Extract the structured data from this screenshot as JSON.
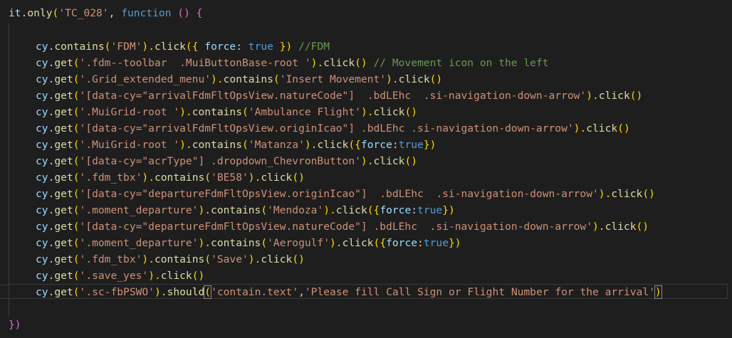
{
  "editor": {
    "lines": [
      {
        "tokens": [
          {
            "t": "it",
            "c": "obj"
          },
          {
            "t": ".",
            "c": "pun"
          },
          {
            "t": "only",
            "c": "fn"
          },
          {
            "t": "(",
            "c": "br2"
          },
          {
            "t": "'TC_028'",
            "c": "str"
          },
          {
            "t": ", ",
            "c": "pun"
          },
          {
            "t": "function",
            "c": "bool"
          },
          {
            "t": " ",
            "c": "pun"
          },
          {
            "t": "()",
            "c": "par"
          },
          {
            "t": " ",
            "c": "pun"
          },
          {
            "t": "{",
            "c": "par"
          }
        ]
      },
      {
        "tokens": [
          {
            "t": "cy",
            "c": "obj"
          },
          {
            "t": ".",
            "c": "pun"
          },
          {
            "t": "contains",
            "c": "fn"
          },
          {
            "t": "(",
            "c": "br2"
          },
          {
            "t": "'FDM'",
            "c": "str"
          },
          {
            "t": ").",
            "c": "br2"
          },
          {
            "t": "click",
            "c": "fn"
          },
          {
            "t": "({ ",
            "c": "br2"
          },
          {
            "t": "force",
            "c": "prop"
          },
          {
            "t": ": ",
            "c": "pun"
          },
          {
            "t": "true",
            "c": "bool"
          },
          {
            "t": " })",
            "c": "br2"
          },
          {
            "t": " //FDM",
            "c": "cm"
          }
        ]
      },
      {
        "tokens": [
          {
            "t": "cy",
            "c": "obj"
          },
          {
            "t": ".",
            "c": "pun"
          },
          {
            "t": "get",
            "c": "fn"
          },
          {
            "t": "(",
            "c": "br2"
          },
          {
            "t": "'.fdm--toolbar  .MuiButtonBase-root '",
            "c": "str"
          },
          {
            "t": ").",
            "c": "br2"
          },
          {
            "t": "click",
            "c": "fn"
          },
          {
            "t": "()",
            "c": "br2"
          },
          {
            "t": " // Movement icon on the left",
            "c": "cm"
          }
        ]
      },
      {
        "tokens": [
          {
            "t": "cy",
            "c": "obj"
          },
          {
            "t": ".",
            "c": "pun"
          },
          {
            "t": "get",
            "c": "fn"
          },
          {
            "t": "(",
            "c": "br2"
          },
          {
            "t": "'.Grid_extended_menu'",
            "c": "str"
          },
          {
            "t": ").",
            "c": "br2"
          },
          {
            "t": "contains",
            "c": "fn"
          },
          {
            "t": "(",
            "c": "br2"
          },
          {
            "t": "'Insert Movement'",
            "c": "str"
          },
          {
            "t": ").",
            "c": "br2"
          },
          {
            "t": "click",
            "c": "fn"
          },
          {
            "t": "()",
            "c": "br2"
          }
        ]
      },
      {
        "tokens": [
          {
            "t": "cy",
            "c": "obj"
          },
          {
            "t": ".",
            "c": "pun"
          },
          {
            "t": "get",
            "c": "fn"
          },
          {
            "t": "(",
            "c": "br2"
          },
          {
            "t": "'[data-cy=\"arrivalFdmFltOpsView.natureCode\"]  .bdLEhc  .si-navigation-down-arrow'",
            "c": "str"
          },
          {
            "t": ").",
            "c": "br2"
          },
          {
            "t": "click",
            "c": "fn"
          },
          {
            "t": "()",
            "c": "br2"
          }
        ]
      },
      {
        "tokens": [
          {
            "t": "cy",
            "c": "obj"
          },
          {
            "t": ".",
            "c": "pun"
          },
          {
            "t": "get",
            "c": "fn"
          },
          {
            "t": "(",
            "c": "br2"
          },
          {
            "t": "'.MuiGrid-root '",
            "c": "str"
          },
          {
            "t": ").",
            "c": "br2"
          },
          {
            "t": "contains",
            "c": "fn"
          },
          {
            "t": "(",
            "c": "br2"
          },
          {
            "t": "'Ambulance Flight'",
            "c": "str"
          },
          {
            "t": ").",
            "c": "br2"
          },
          {
            "t": "click",
            "c": "fn"
          },
          {
            "t": "()",
            "c": "br2"
          }
        ]
      },
      {
        "tokens": [
          {
            "t": "cy",
            "c": "obj"
          },
          {
            "t": ".",
            "c": "pun"
          },
          {
            "t": "get",
            "c": "fn"
          },
          {
            "t": "(",
            "c": "br2"
          },
          {
            "t": "'[data-cy=\"arrivalFdmFltOpsView.originIcao\"] .bdLEhc .si-navigation-down-arrow'",
            "c": "str"
          },
          {
            "t": ").",
            "c": "br2"
          },
          {
            "t": "click",
            "c": "fn"
          },
          {
            "t": "()",
            "c": "br2"
          }
        ]
      },
      {
        "tokens": [
          {
            "t": "cy",
            "c": "obj"
          },
          {
            "t": ".",
            "c": "pun"
          },
          {
            "t": "get",
            "c": "fn"
          },
          {
            "t": "(",
            "c": "br2"
          },
          {
            "t": "'.MuiGrid-root '",
            "c": "str"
          },
          {
            "t": ").",
            "c": "br2"
          },
          {
            "t": "contains",
            "c": "fn"
          },
          {
            "t": "(",
            "c": "br2"
          },
          {
            "t": "'Matanza'",
            "c": "str"
          },
          {
            "t": ").",
            "c": "br2"
          },
          {
            "t": "click",
            "c": "fn"
          },
          {
            "t": "({",
            "c": "br2"
          },
          {
            "t": "force",
            "c": "prop"
          },
          {
            "t": ":",
            "c": "pun"
          },
          {
            "t": "true",
            "c": "bool"
          },
          {
            "t": "})",
            "c": "br2"
          }
        ]
      },
      {
        "tokens": [
          {
            "t": "cy",
            "c": "obj"
          },
          {
            "t": ".",
            "c": "pun"
          },
          {
            "t": "get",
            "c": "fn"
          },
          {
            "t": "(",
            "c": "br2"
          },
          {
            "t": "'[data-cy=\"acrType\"] .dropdown_ChevronButton'",
            "c": "str"
          },
          {
            "t": ").",
            "c": "br2"
          },
          {
            "t": "click",
            "c": "fn"
          },
          {
            "t": "()",
            "c": "br2"
          }
        ]
      },
      {
        "tokens": [
          {
            "t": "cy",
            "c": "obj"
          },
          {
            "t": ".",
            "c": "pun"
          },
          {
            "t": "get",
            "c": "fn"
          },
          {
            "t": "(",
            "c": "br2"
          },
          {
            "t": "'.fdm_tbx'",
            "c": "str"
          },
          {
            "t": ").",
            "c": "br2"
          },
          {
            "t": "contains",
            "c": "fn"
          },
          {
            "t": "(",
            "c": "br2"
          },
          {
            "t": "'BE58'",
            "c": "str"
          },
          {
            "t": ").",
            "c": "br2"
          },
          {
            "t": "click",
            "c": "fn"
          },
          {
            "t": "()",
            "c": "br2"
          }
        ]
      },
      {
        "tokens": [
          {
            "t": "cy",
            "c": "obj"
          },
          {
            "t": ".",
            "c": "pun"
          },
          {
            "t": "get",
            "c": "fn"
          },
          {
            "t": "(",
            "c": "br2"
          },
          {
            "t": "'[data-cy=\"departureFdmFltOpsView.originIcao\"]  .bdLEhc  .si-navigation-down-arrow'",
            "c": "str"
          },
          {
            "t": ").",
            "c": "br2"
          },
          {
            "t": "click",
            "c": "fn"
          },
          {
            "t": "()",
            "c": "br2"
          }
        ]
      },
      {
        "tokens": [
          {
            "t": "cy",
            "c": "obj"
          },
          {
            "t": ".",
            "c": "pun"
          },
          {
            "t": "get",
            "c": "fn"
          },
          {
            "t": "(",
            "c": "br2"
          },
          {
            "t": "'.moment_departure'",
            "c": "str"
          },
          {
            "t": ").",
            "c": "br2"
          },
          {
            "t": "contains",
            "c": "fn"
          },
          {
            "t": "(",
            "c": "br2"
          },
          {
            "t": "'Mendoza'",
            "c": "str"
          },
          {
            "t": ").",
            "c": "br2"
          },
          {
            "t": "click",
            "c": "fn"
          },
          {
            "t": "({",
            "c": "br2"
          },
          {
            "t": "force",
            "c": "prop"
          },
          {
            "t": ":",
            "c": "pun"
          },
          {
            "t": "true",
            "c": "bool"
          },
          {
            "t": "})",
            "c": "br2"
          }
        ]
      },
      {
        "tokens": [
          {
            "t": "cy",
            "c": "obj"
          },
          {
            "t": ".",
            "c": "pun"
          },
          {
            "t": "get",
            "c": "fn"
          },
          {
            "t": "(",
            "c": "br2"
          },
          {
            "t": "'[data-cy=\"departureFdmFltOpsView.natureCode\"] .bdLEhc  .si-navigation-down-arrow'",
            "c": "str"
          },
          {
            "t": ").",
            "c": "br2"
          },
          {
            "t": "click",
            "c": "fn"
          },
          {
            "t": "()",
            "c": "br2"
          }
        ]
      },
      {
        "tokens": [
          {
            "t": "cy",
            "c": "obj"
          },
          {
            "t": ".",
            "c": "pun"
          },
          {
            "t": "get",
            "c": "fn"
          },
          {
            "t": "(",
            "c": "br2"
          },
          {
            "t": "'.moment_departure'",
            "c": "str"
          },
          {
            "t": ").",
            "c": "br2"
          },
          {
            "t": "contains",
            "c": "fn"
          },
          {
            "t": "(",
            "c": "br2"
          },
          {
            "t": "'Aerogulf'",
            "c": "str"
          },
          {
            "t": ").",
            "c": "br2"
          },
          {
            "t": "click",
            "c": "fn"
          },
          {
            "t": "({",
            "c": "br2"
          },
          {
            "t": "force",
            "c": "prop"
          },
          {
            "t": ":",
            "c": "pun"
          },
          {
            "t": "true",
            "c": "bool"
          },
          {
            "t": "})",
            "c": "br2"
          }
        ]
      },
      {
        "tokens": [
          {
            "t": "cy",
            "c": "obj"
          },
          {
            "t": ".",
            "c": "pun"
          },
          {
            "t": "get",
            "c": "fn"
          },
          {
            "t": "(",
            "c": "br2"
          },
          {
            "t": "'.fdm_tbx'",
            "c": "str"
          },
          {
            "t": ").",
            "c": "br2"
          },
          {
            "t": "contains",
            "c": "fn"
          },
          {
            "t": "(",
            "c": "br2"
          },
          {
            "t": "'Save'",
            "c": "str"
          },
          {
            "t": ").",
            "c": "br2"
          },
          {
            "t": "click",
            "c": "fn"
          },
          {
            "t": "()",
            "c": "br2"
          }
        ]
      },
      {
        "tokens": [
          {
            "t": "cy",
            "c": "obj"
          },
          {
            "t": ".",
            "c": "pun"
          },
          {
            "t": "get",
            "c": "fn"
          },
          {
            "t": "(",
            "c": "br2"
          },
          {
            "t": "'.save_yes'",
            "c": "str"
          },
          {
            "t": ").",
            "c": "br2"
          },
          {
            "t": "click",
            "c": "fn"
          },
          {
            "t": "()",
            "c": "br2"
          }
        ]
      },
      {
        "tokens": [
          {
            "t": "cy",
            "c": "obj"
          },
          {
            "t": ".",
            "c": "pun"
          },
          {
            "t": "get",
            "c": "fn"
          },
          {
            "t": "(",
            "c": "br2"
          },
          {
            "t": "'.sc-fbPSWO'",
            "c": "str"
          },
          {
            "t": ").",
            "c": "br2"
          },
          {
            "t": "should",
            "c": "fn"
          },
          {
            "t": "(",
            "c": "br2",
            "match": true
          },
          {
            "t": "'contain.text'",
            "c": "str"
          },
          {
            "t": ",",
            "c": "pun"
          },
          {
            "t": "'Please fill Call Sign or Flight Number for the arrival'",
            "c": "str"
          },
          {
            "t": ")",
            "c": "br2",
            "match": true,
            "cursor": true
          }
        ]
      },
      {
        "tokens": [
          {
            "t": "})",
            "c": "par"
          }
        ]
      }
    ]
  },
  "colors": {
    "background": "#1e1e1e",
    "string": "#ce9178",
    "function": "#dcdcaa",
    "variable": "#9cdcfe",
    "keyword": "#569cd6",
    "comment": "#6a9955",
    "bracket": "#ffd700"
  }
}
